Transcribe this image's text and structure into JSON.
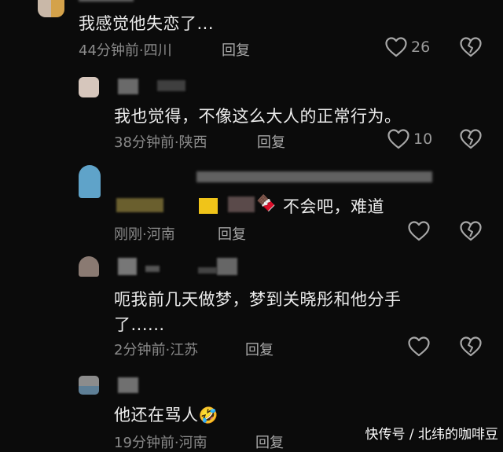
{
  "comments": [
    {
      "text": "我感觉他失恋了...",
      "time": "44分钟前",
      "location": "四川",
      "reply": "回复",
      "likes": "26"
    },
    {
      "text": "我也觉得，不像这么大人的正常行为。",
      "time": "38分钟前",
      "location": "陕西",
      "reply": "回复",
      "likes": "10"
    },
    {
      "text": "不会吧，难道",
      "time": "刚刚",
      "location": "河南",
      "reply": "回复"
    },
    {
      "text_line1": "呃我前几天做梦，梦到关晓彤和他分手",
      "text_line2": "了......",
      "time": "2分钟前",
      "location": "江苏",
      "reply": "回复"
    },
    {
      "text": "他还在骂人",
      "time": "19分钟前",
      "location": "河南",
      "reply": "回复"
    }
  ],
  "separator": "·",
  "watermark": "快传号 / 北纬的咖啡豆",
  "icons": {
    "like": "heart-outline-icon",
    "dislike": "broken-heart-icon",
    "chocolate": "chocolate-emoji",
    "laugh": "rofl-emoji"
  }
}
